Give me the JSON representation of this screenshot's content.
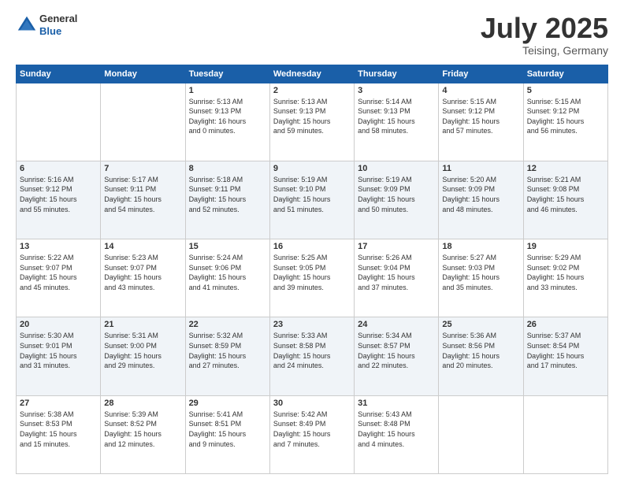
{
  "header": {
    "logo_general": "General",
    "logo_blue": "Blue",
    "title": "July 2025",
    "location": "Teising, Germany"
  },
  "days_of_week": [
    "Sunday",
    "Monday",
    "Tuesday",
    "Wednesday",
    "Thursday",
    "Friday",
    "Saturday"
  ],
  "weeks": [
    [
      {
        "day": "",
        "content": ""
      },
      {
        "day": "",
        "content": ""
      },
      {
        "day": "1",
        "content": "Sunrise: 5:13 AM\nSunset: 9:13 PM\nDaylight: 16 hours\nand 0 minutes."
      },
      {
        "day": "2",
        "content": "Sunrise: 5:13 AM\nSunset: 9:13 PM\nDaylight: 15 hours\nand 59 minutes."
      },
      {
        "day": "3",
        "content": "Sunrise: 5:14 AM\nSunset: 9:13 PM\nDaylight: 15 hours\nand 58 minutes."
      },
      {
        "day": "4",
        "content": "Sunrise: 5:15 AM\nSunset: 9:12 PM\nDaylight: 15 hours\nand 57 minutes."
      },
      {
        "day": "5",
        "content": "Sunrise: 5:15 AM\nSunset: 9:12 PM\nDaylight: 15 hours\nand 56 minutes."
      }
    ],
    [
      {
        "day": "6",
        "content": "Sunrise: 5:16 AM\nSunset: 9:12 PM\nDaylight: 15 hours\nand 55 minutes."
      },
      {
        "day": "7",
        "content": "Sunrise: 5:17 AM\nSunset: 9:11 PM\nDaylight: 15 hours\nand 54 minutes."
      },
      {
        "day": "8",
        "content": "Sunrise: 5:18 AM\nSunset: 9:11 PM\nDaylight: 15 hours\nand 52 minutes."
      },
      {
        "day": "9",
        "content": "Sunrise: 5:19 AM\nSunset: 9:10 PM\nDaylight: 15 hours\nand 51 minutes."
      },
      {
        "day": "10",
        "content": "Sunrise: 5:19 AM\nSunset: 9:09 PM\nDaylight: 15 hours\nand 50 minutes."
      },
      {
        "day": "11",
        "content": "Sunrise: 5:20 AM\nSunset: 9:09 PM\nDaylight: 15 hours\nand 48 minutes."
      },
      {
        "day": "12",
        "content": "Sunrise: 5:21 AM\nSunset: 9:08 PM\nDaylight: 15 hours\nand 46 minutes."
      }
    ],
    [
      {
        "day": "13",
        "content": "Sunrise: 5:22 AM\nSunset: 9:07 PM\nDaylight: 15 hours\nand 45 minutes."
      },
      {
        "day": "14",
        "content": "Sunrise: 5:23 AM\nSunset: 9:07 PM\nDaylight: 15 hours\nand 43 minutes."
      },
      {
        "day": "15",
        "content": "Sunrise: 5:24 AM\nSunset: 9:06 PM\nDaylight: 15 hours\nand 41 minutes."
      },
      {
        "day": "16",
        "content": "Sunrise: 5:25 AM\nSunset: 9:05 PM\nDaylight: 15 hours\nand 39 minutes."
      },
      {
        "day": "17",
        "content": "Sunrise: 5:26 AM\nSunset: 9:04 PM\nDaylight: 15 hours\nand 37 minutes."
      },
      {
        "day": "18",
        "content": "Sunrise: 5:27 AM\nSunset: 9:03 PM\nDaylight: 15 hours\nand 35 minutes."
      },
      {
        "day": "19",
        "content": "Sunrise: 5:29 AM\nSunset: 9:02 PM\nDaylight: 15 hours\nand 33 minutes."
      }
    ],
    [
      {
        "day": "20",
        "content": "Sunrise: 5:30 AM\nSunset: 9:01 PM\nDaylight: 15 hours\nand 31 minutes."
      },
      {
        "day": "21",
        "content": "Sunrise: 5:31 AM\nSunset: 9:00 PM\nDaylight: 15 hours\nand 29 minutes."
      },
      {
        "day": "22",
        "content": "Sunrise: 5:32 AM\nSunset: 8:59 PM\nDaylight: 15 hours\nand 27 minutes."
      },
      {
        "day": "23",
        "content": "Sunrise: 5:33 AM\nSunset: 8:58 PM\nDaylight: 15 hours\nand 24 minutes."
      },
      {
        "day": "24",
        "content": "Sunrise: 5:34 AM\nSunset: 8:57 PM\nDaylight: 15 hours\nand 22 minutes."
      },
      {
        "day": "25",
        "content": "Sunrise: 5:36 AM\nSunset: 8:56 PM\nDaylight: 15 hours\nand 20 minutes."
      },
      {
        "day": "26",
        "content": "Sunrise: 5:37 AM\nSunset: 8:54 PM\nDaylight: 15 hours\nand 17 minutes."
      }
    ],
    [
      {
        "day": "27",
        "content": "Sunrise: 5:38 AM\nSunset: 8:53 PM\nDaylight: 15 hours\nand 15 minutes."
      },
      {
        "day": "28",
        "content": "Sunrise: 5:39 AM\nSunset: 8:52 PM\nDaylight: 15 hours\nand 12 minutes."
      },
      {
        "day": "29",
        "content": "Sunrise: 5:41 AM\nSunset: 8:51 PM\nDaylight: 15 hours\nand 9 minutes."
      },
      {
        "day": "30",
        "content": "Sunrise: 5:42 AM\nSunset: 8:49 PM\nDaylight: 15 hours\nand 7 minutes."
      },
      {
        "day": "31",
        "content": "Sunrise: 5:43 AM\nSunset: 8:48 PM\nDaylight: 15 hours\nand 4 minutes."
      },
      {
        "day": "",
        "content": ""
      },
      {
        "day": "",
        "content": ""
      }
    ]
  ]
}
